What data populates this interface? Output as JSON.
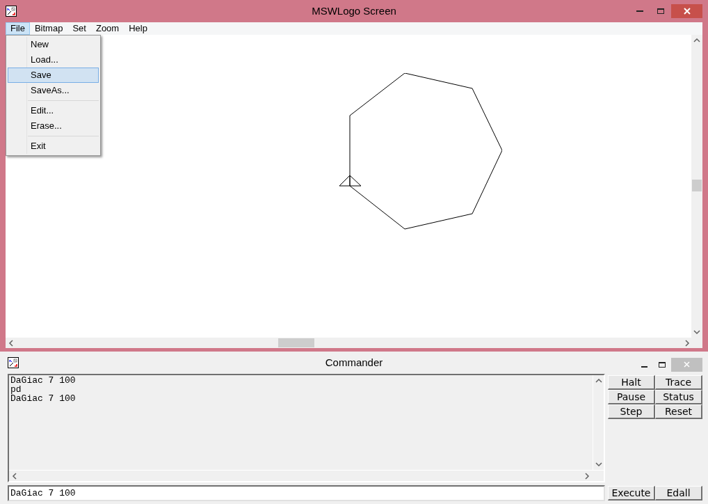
{
  "window": {
    "title": "MSWLogo Screen"
  },
  "menu_bar": [
    {
      "label": "File",
      "selected": true
    },
    {
      "label": "Bitmap",
      "selected": false
    },
    {
      "label": "Set",
      "selected": false
    },
    {
      "label": "Zoom",
      "selected": false
    },
    {
      "label": "Help",
      "selected": false
    }
  ],
  "file_menu": [
    {
      "kind": "item",
      "label": "New",
      "selected": false
    },
    {
      "kind": "item",
      "label": "Load...",
      "selected": false
    },
    {
      "kind": "item",
      "label": "Save",
      "selected": true
    },
    {
      "kind": "item",
      "label": "SaveAs...",
      "selected": false
    },
    {
      "kind": "separator"
    },
    {
      "kind": "item",
      "label": "Edit...",
      "selected": false
    },
    {
      "kind": "item",
      "label": "Erase...",
      "selected": false
    },
    {
      "kind": "separator"
    },
    {
      "kind": "item",
      "label": "Exit",
      "selected": false
    }
  ],
  "commander": {
    "title": "Commander",
    "history": [
      "DaGiac 7 100",
      "pd",
      "DaGiac 7 100"
    ],
    "input": {
      "value": "DaGiac 7 100"
    },
    "buttons": [
      "Halt",
      "Trace",
      "Pause",
      "Status",
      "Step",
      "Reset"
    ],
    "bottom_buttons": [
      "Execute",
      "Edall"
    ]
  }
}
